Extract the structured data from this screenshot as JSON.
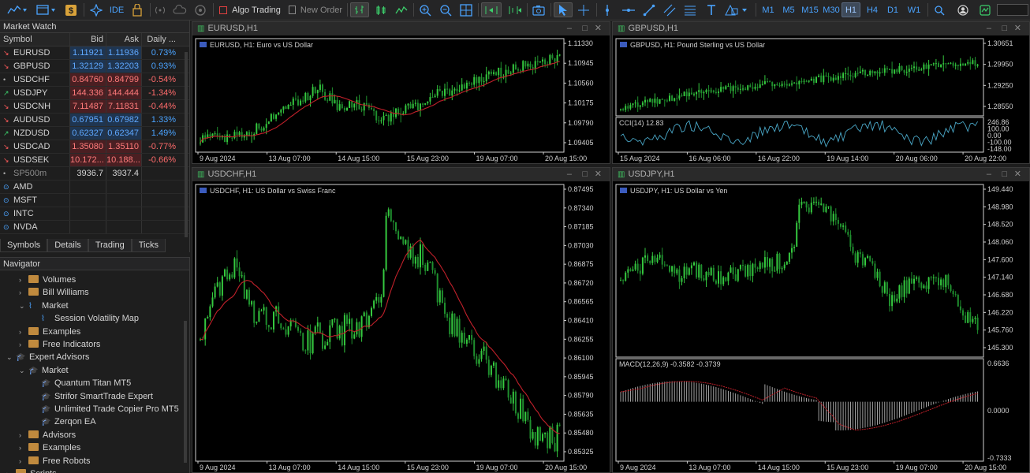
{
  "toolbar": {
    "algo_trading": "Algo Trading",
    "new_order": "New Order",
    "ide": "IDE",
    "timeframes": [
      "M1",
      "M5",
      "M15",
      "M30",
      "H1",
      "H4",
      "D1",
      "W1"
    ],
    "active_timeframe": "H1"
  },
  "market_watch": {
    "title": "Market Watch",
    "columns": [
      "Symbol",
      "Bid",
      "Ask",
      "Daily ..."
    ],
    "rows": [
      {
        "symbol": "EURUSD",
        "bid": "1.11921",
        "ask": "1.11936",
        "daily": "0.73%",
        "dir": "down",
        "tone": "up"
      },
      {
        "symbol": "GBPUSD",
        "bid": "1.32129",
        "ask": "1.32203",
        "daily": "0.93%",
        "dir": "down",
        "tone": "up"
      },
      {
        "symbol": "USDCHF",
        "bid": "0.84760",
        "ask": "0.84799",
        "daily": "-0.54%",
        "dir": "dot",
        "tone": "dn"
      },
      {
        "symbol": "USDJPY",
        "bid": "144.336",
        "ask": "144.444",
        "daily": "-1.34%",
        "dir": "up",
        "tone": "dn"
      },
      {
        "symbol": "USDCNH",
        "bid": "7.11487",
        "ask": "7.11831",
        "daily": "-0.44%",
        "dir": "down",
        "tone": "dn"
      },
      {
        "symbol": "AUDUSD",
        "bid": "0.67951",
        "ask": "0.67982",
        "daily": "1.33%",
        "dir": "down",
        "tone": "up"
      },
      {
        "symbol": "NZDUSD",
        "bid": "0.62327",
        "ask": "0.62347",
        "daily": "1.49%",
        "dir": "up",
        "tone": "up"
      },
      {
        "symbol": "USDCAD",
        "bid": "1.35080",
        "ask": "1.35110",
        "daily": "-0.77%",
        "dir": "down",
        "tone": "dn"
      },
      {
        "symbol": "USDSEK",
        "bid": "10.172...",
        "ask": "10.188...",
        "daily": "-0.66%",
        "dir": "down",
        "tone": "dn"
      },
      {
        "symbol": "SP500m",
        "bid": "3936.7",
        "ask": "3937.4",
        "daily": "",
        "dir": "dot",
        "tone": "neutral"
      },
      {
        "symbol": "AMD",
        "bid": "",
        "ask": "",
        "daily": "",
        "dir": "ring",
        "tone": "neutral"
      },
      {
        "symbol": "MSFT",
        "bid": "",
        "ask": "",
        "daily": "",
        "dir": "ring",
        "tone": "neutral"
      },
      {
        "symbol": "INTC",
        "bid": "",
        "ask": "",
        "daily": "",
        "dir": "ring",
        "tone": "neutral"
      },
      {
        "symbol": "NVDA",
        "bid": "",
        "ask": "",
        "daily": "",
        "dir": "ring",
        "tone": "neutral"
      }
    ],
    "tabs": [
      "Symbols",
      "Details",
      "Trading",
      "Ticks"
    ],
    "active_tab": "Symbols"
  },
  "navigator": {
    "title": "Navigator",
    "items": [
      {
        "label": "Volumes",
        "kind": "folder",
        "indent": 1,
        "chev": "right"
      },
      {
        "label": "Bill Williams",
        "kind": "folder",
        "indent": 1,
        "chev": "right"
      },
      {
        "label": "Market",
        "kind": "chart",
        "indent": 1,
        "chev": "down"
      },
      {
        "label": "Session Volatility Map",
        "kind": "chart",
        "indent": 2,
        "chev": ""
      },
      {
        "label": "Examples",
        "kind": "folder",
        "indent": 1,
        "chev": "right"
      },
      {
        "label": "Free Indicators",
        "kind": "folder",
        "indent": 1,
        "chev": "right"
      },
      {
        "label": "Expert Advisors",
        "kind": "hat",
        "indent": 0,
        "chev": "down"
      },
      {
        "label": "Market",
        "kind": "hat",
        "indent": 1,
        "chev": "down"
      },
      {
        "label": "Quantum Titan MT5",
        "kind": "hat",
        "indent": 2,
        "chev": ""
      },
      {
        "label": "Strifor SmartTrade Expert",
        "kind": "hat",
        "indent": 2,
        "chev": ""
      },
      {
        "label": "Unlimited Trade Copier Pro MT5",
        "kind": "hat",
        "indent": 2,
        "chev": ""
      },
      {
        "label": "Zerqon EA",
        "kind": "hat",
        "indent": 2,
        "chev": ""
      },
      {
        "label": "Advisors",
        "kind": "folder",
        "indent": 1,
        "chev": "right"
      },
      {
        "label": "Examples",
        "kind": "folder",
        "indent": 1,
        "chev": "right"
      },
      {
        "label": "Free Robots",
        "kind": "folder",
        "indent": 1,
        "chev": "right"
      },
      {
        "label": "Scripts",
        "kind": "folder",
        "indent": 0,
        "chev": "right"
      }
    ]
  },
  "charts": [
    {
      "id": "eurusd",
      "title": "EURUSD,H1",
      "caption": "EURUSD, H1:  Euro vs US Dollar",
      "y_ticks": [
        "1.11330",
        "1.10945",
        "1.10560",
        "1.10175",
        "1.09790",
        "1.09405"
      ],
      "x_ticks": [
        "9 Aug 2024",
        "13 Aug 07:00",
        "14 Aug 15:00",
        "15 Aug 23:00",
        "19 Aug 07:00",
        "20 Aug 15:00"
      ],
      "subwindow": null
    },
    {
      "id": "gbpusd",
      "title": "GBPUSD,H1",
      "caption": "GBPUSD, H1:  Pound Sterling vs US Dollar",
      "y_ticks": [
        "1.30651",
        "1.29950",
        "1.29250",
        "1.28550"
      ],
      "x_ticks": [
        "15 Aug 2024",
        "16 Aug 06:00",
        "16 Aug 22:00",
        "19 Aug 14:00",
        "20 Aug 06:00",
        "20 Aug 22:00"
      ],
      "subwindow": {
        "label": "CCI(14) 12.83",
        "ticks": [
          "246.86",
          "100.00",
          "0.00",
          "-100.00",
          "-148.00"
        ]
      }
    },
    {
      "id": "usdchf",
      "title": "USDCHF,H1",
      "caption": "USDCHF, H1:  US Dollar vs Swiss Franc",
      "y_ticks": [
        "0.87495",
        "0.87340",
        "0.87185",
        "0.87030",
        "0.86875",
        "0.86720",
        "0.86565",
        "0.86410",
        "0.86255",
        "0.86100",
        "0.85945",
        "0.85790",
        "0.85635",
        "0.85480",
        "0.85325"
      ],
      "x_ticks": [
        "9 Aug 2024",
        "13 Aug 07:00",
        "14 Aug 15:00",
        "15 Aug 23:00",
        "19 Aug 07:00",
        "20 Aug 15:00"
      ],
      "subwindow": null
    },
    {
      "id": "usdjpy",
      "title": "USDJPY,H1",
      "caption": "USDJPY, H1:  US Dollar vs Yen",
      "y_ticks": [
        "149.440",
        "148.980",
        "148.520",
        "148.060",
        "147.600",
        "147.140",
        "146.680",
        "146.220",
        "145.760",
        "145.300"
      ],
      "x_ticks": [
        "9 Aug 2024",
        "13 Aug 07:00",
        "14 Aug 15:00",
        "15 Aug 23:00",
        "19 Aug 07:00",
        "20 Aug 15:00"
      ],
      "subwindow": {
        "label": "MACD(12,26,9) -0.3582 -0.3739",
        "ticks": [
          "0.6636",
          "0.0000",
          "-0.7333"
        ]
      }
    }
  ],
  "colors": {
    "bull": "#2fbf3f",
    "bear": "#1e7d2a",
    "ma": "#c0202a",
    "grid": "#1a1a1a",
    "accent": "#4aa3ff"
  }
}
